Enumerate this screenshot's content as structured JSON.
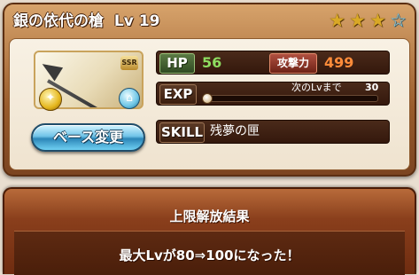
{
  "weapon": {
    "name": "銀の依代の槍",
    "level_label": "Lv",
    "level": "19",
    "rarity": "SSR",
    "stars": {
      "filled": 3,
      "total": 4
    }
  },
  "base_change": {
    "label": "ベース変更"
  },
  "stats": {
    "hp_label": "HP",
    "hp": "56",
    "atk_label": "攻撃力",
    "atk": "499",
    "exp_label": "EXP",
    "next_level_text": "次のLvまで",
    "next_level_exp": "30",
    "exp_progress": 0.0,
    "skill_label": "SKILL",
    "skill_name": "残夢の匣"
  },
  "result": {
    "title": "上限解放結果",
    "message": "最大Lvが80⇒100になった！"
  },
  "colors": {
    "frame": "#9a5c2c",
    "hp_value": "#8edc60",
    "atk_value": "#ff8c3a",
    "button": "#6fc3e8"
  }
}
